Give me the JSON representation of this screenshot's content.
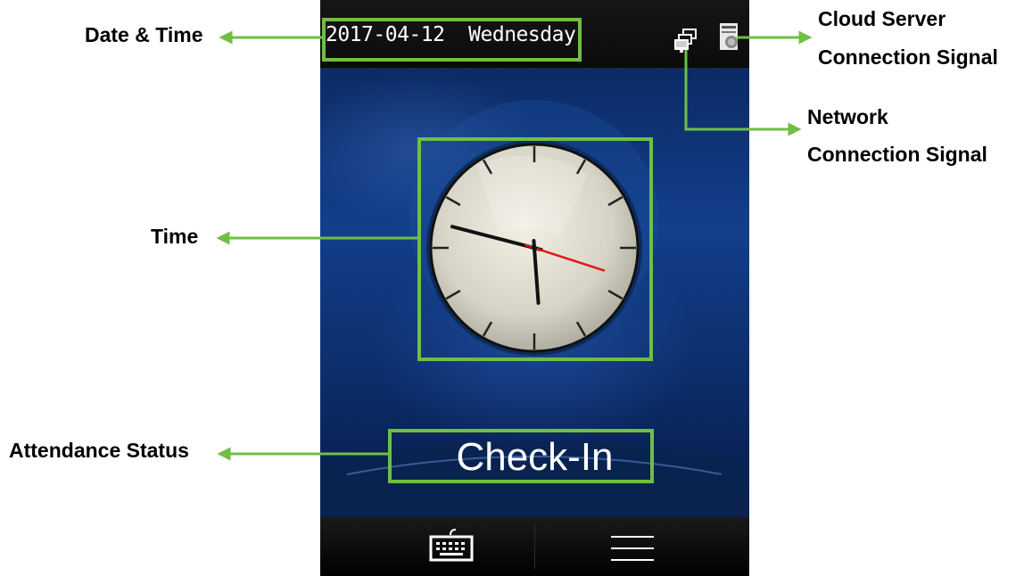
{
  "device": {
    "date_time": "2017-04-12  Wednesday",
    "attendance_status": "Check-In",
    "clock": {
      "hour": 9,
      "minute": 29,
      "second": 18
    },
    "icons": {
      "network": "network-connection-icon",
      "cloud": "cloud-server-icon",
      "keyboard": "keyboard-icon",
      "menu": "menu-icon"
    }
  },
  "callouts": {
    "date_time": "Date & Time",
    "cloud_line1": "Cloud Server",
    "cloud_line2": "Connection Signal",
    "network_line1": "Network",
    "network_line2": "Connection Signal",
    "time": "Time",
    "attendance": "Attendance Status"
  },
  "colors": {
    "highlight": "#6fbf44",
    "second_hand": "#e01818",
    "screen_blue": "#123e8a"
  }
}
